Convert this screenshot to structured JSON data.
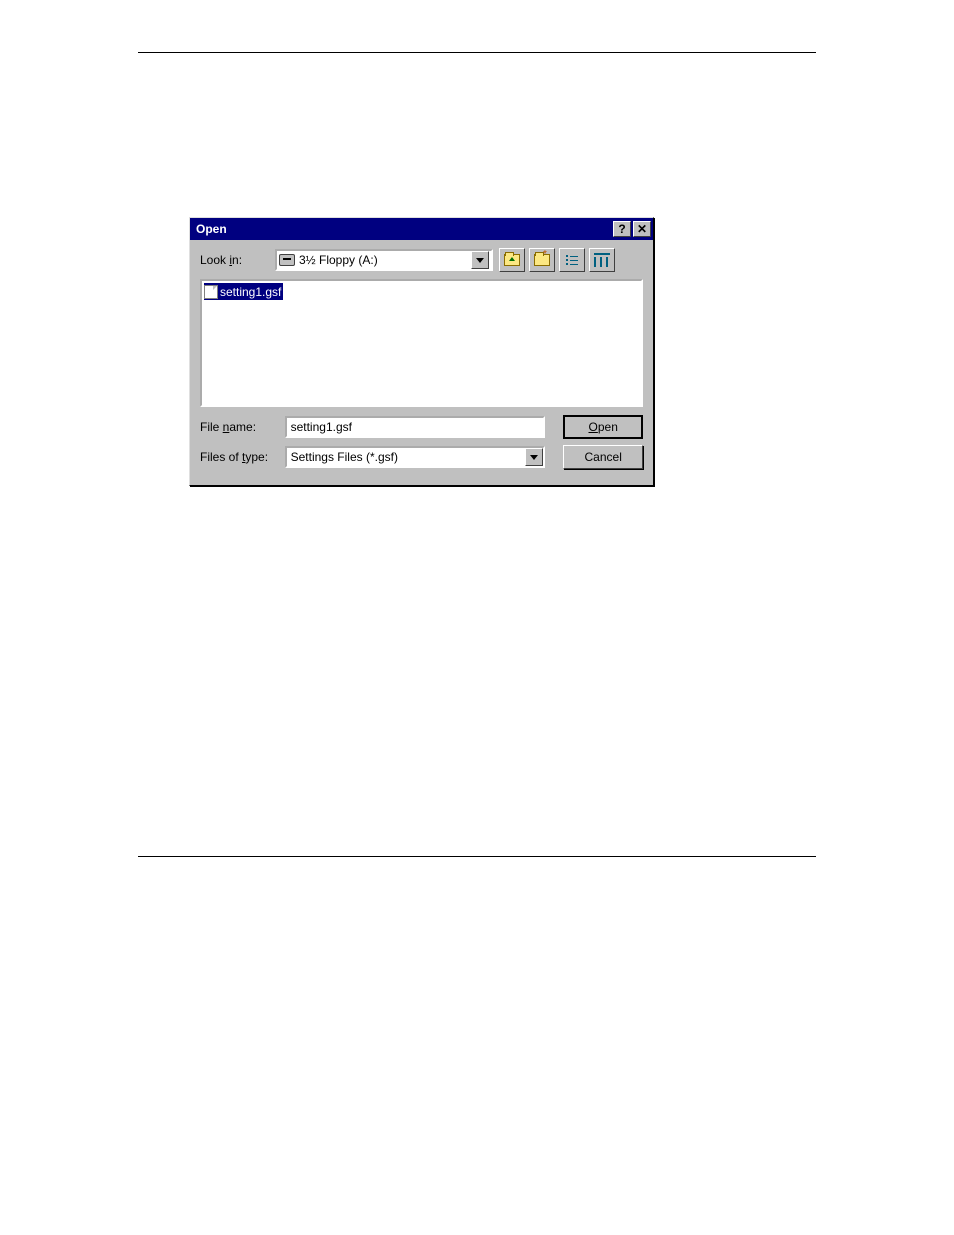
{
  "dialog": {
    "title": "Open",
    "look_in_label_pre": "Look ",
    "look_in_label_u": "i",
    "look_in_label_post": "n:",
    "look_in_value": "3½ Floppy (A:)",
    "file_list": [
      {
        "name": "setting1.gsf",
        "selected": true
      }
    ],
    "filename_label_pre": "File ",
    "filename_label_u": "n",
    "filename_label_post": "ame:",
    "filename_value": "setting1.gsf",
    "filetype_label_pre": "Files of ",
    "filetype_label_u": "t",
    "filetype_label_post": "ype:",
    "filetype_value": "Settings Files (*.gsf)",
    "open_btn_u": "O",
    "open_btn_post": "pen",
    "cancel_btn": "Cancel"
  },
  "toolbar_icons": {
    "up": "up-one-level-icon",
    "new": "create-new-folder-icon",
    "list": "list-view-icon",
    "details": "details-view-icon"
  }
}
